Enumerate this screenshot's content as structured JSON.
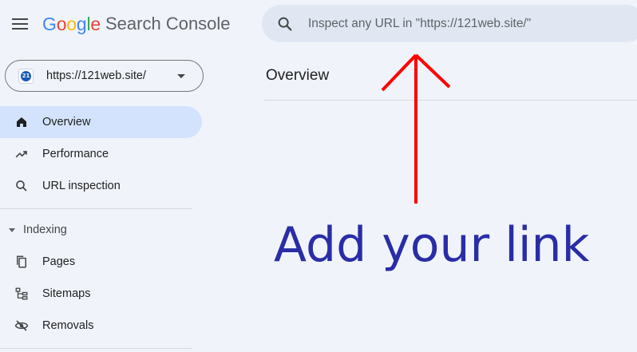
{
  "header": {
    "logo_letters": [
      {
        "char": "G",
        "color": "#4285F4"
      },
      {
        "char": "o",
        "color": "#EA4335"
      },
      {
        "char": "o",
        "color": "#FBBC05"
      },
      {
        "char": "g",
        "color": "#4285F4"
      },
      {
        "char": "l",
        "color": "#34A853"
      },
      {
        "char": "e",
        "color": "#EA4335"
      }
    ],
    "product_name": "Search Console",
    "menu_icon": "hamburger-menu-icon",
    "search": {
      "icon": "search-icon",
      "placeholder": "Inspect any URL in \"https://121web.site/\""
    }
  },
  "property": {
    "url": "https://121web.site/",
    "favicon": "site-favicon-icon",
    "dropdown_icon": "dropdown-caret-icon"
  },
  "sidebar": {
    "items": [
      {
        "label": "Overview",
        "icon": "home-icon",
        "active": true
      },
      {
        "label": "Performance",
        "icon": "trending-up-icon",
        "active": false
      },
      {
        "label": "URL inspection",
        "icon": "search-icon",
        "active": false
      }
    ],
    "sections": [
      {
        "title": "Indexing",
        "items": [
          {
            "label": "Pages",
            "icon": "pages-icon"
          },
          {
            "label": "Sitemaps",
            "icon": "sitemap-icon"
          },
          {
            "label": "Removals",
            "icon": "visibility-off-icon"
          }
        ]
      }
    ]
  },
  "main": {
    "title": "Overview"
  },
  "annotation": {
    "text": "Add your link",
    "arrow_color": "#ff0000",
    "text_color": "#2a2da6"
  },
  "colors": {
    "background": "#f0f4fa",
    "active_nav": "#d3e3fd",
    "search_bg": "#e1e7f2"
  }
}
